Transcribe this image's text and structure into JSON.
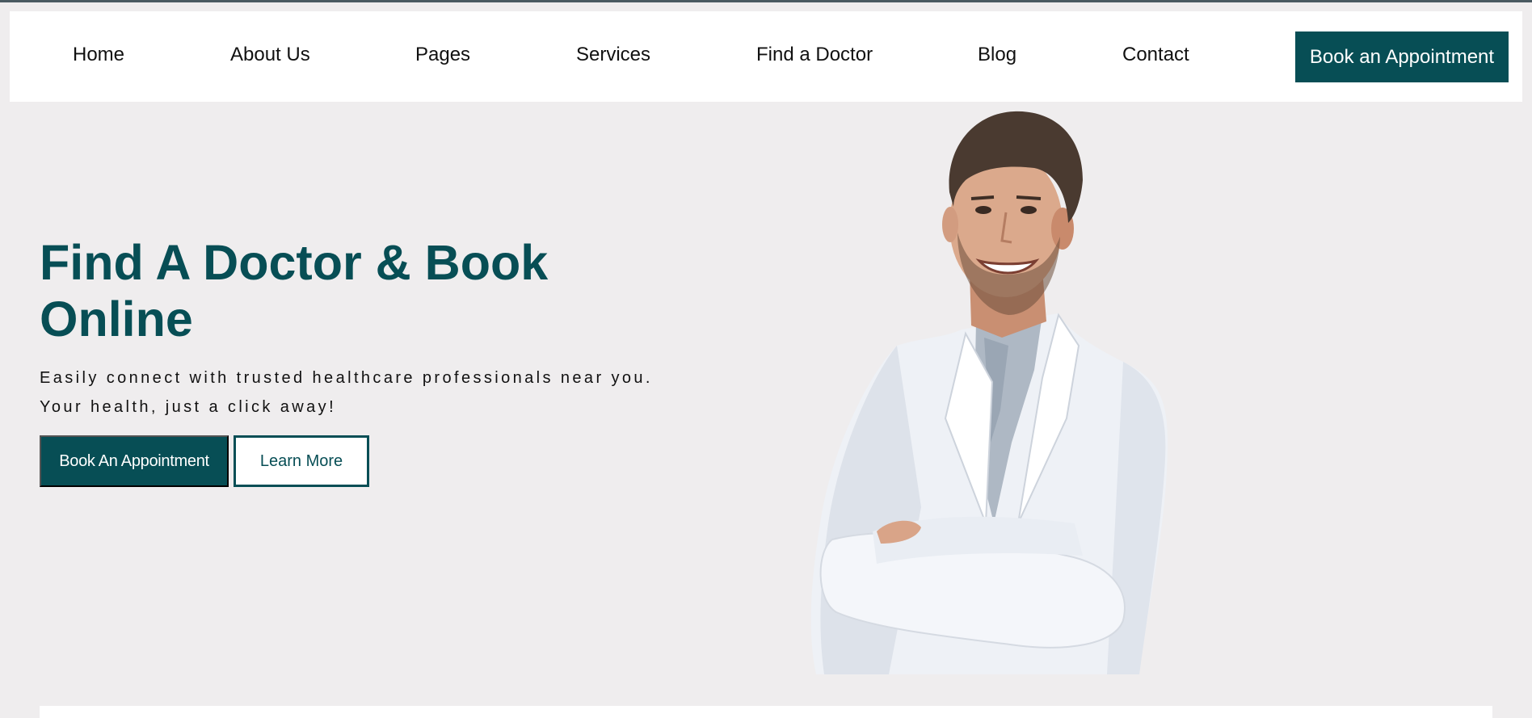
{
  "nav": {
    "items": [
      {
        "label": "Home"
      },
      {
        "label": "About Us"
      },
      {
        "label": "Pages"
      },
      {
        "label": "Services"
      },
      {
        "label": "Find a Doctor"
      },
      {
        "label": "Blog"
      },
      {
        "label": "Contact"
      }
    ],
    "cta_label": "Book an Appointment"
  },
  "hero": {
    "title_line1": "Find A Doctor & Book",
    "title_line2": "Online",
    "subtitle_line1": "Easily connect with trusted healthcare professionals near you.",
    "subtitle_line2": "Your health, just a click away!",
    "primary_button": "Book An Appointment",
    "secondary_button": "Learn More",
    "image": "doctor-in-white-coat-arms-crossed"
  },
  "colors": {
    "brand": "#074e55",
    "background": "#efedee",
    "nav_background": "#ffffff"
  }
}
